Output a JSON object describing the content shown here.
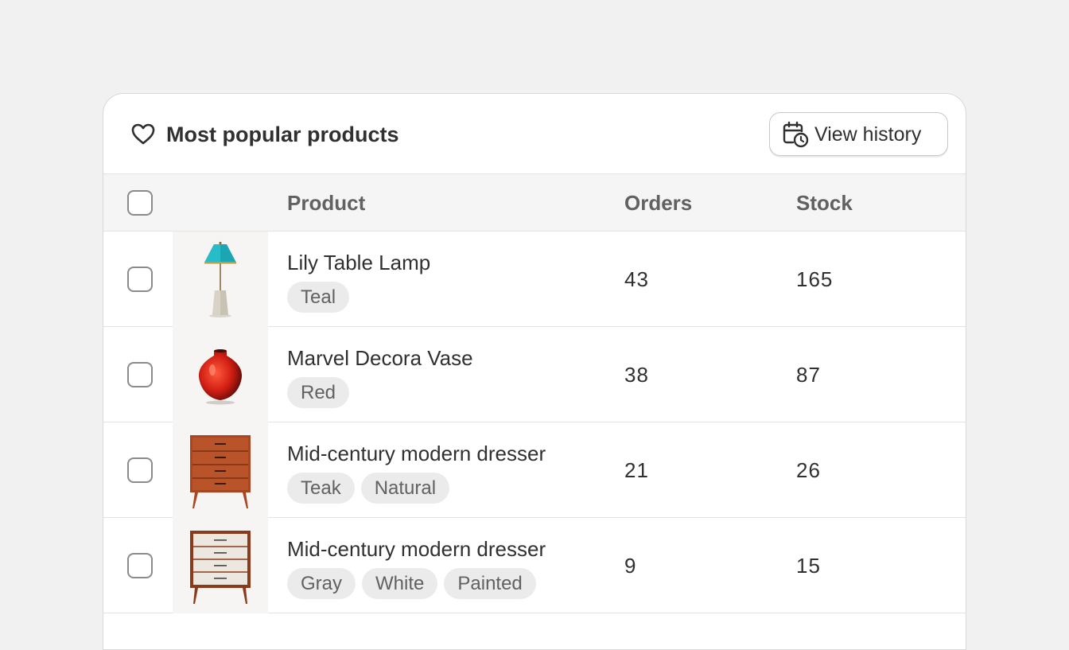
{
  "card": {
    "title": "Most popular products",
    "title_icon": "heart-icon",
    "history_button": {
      "label": "View history",
      "icon": "calendar-clock-icon"
    }
  },
  "table": {
    "columns": {
      "product": "Product",
      "orders": "Orders",
      "stock": "Stock"
    },
    "rows": [
      {
        "name": "Lily Table Lamp",
        "tags": [
          "Teal"
        ],
        "orders": "43",
        "stock": "165",
        "image": "table-lamp"
      },
      {
        "name": "Marvel Decora Vase",
        "tags": [
          "Red"
        ],
        "orders": "38",
        "stock": "87",
        "image": "vase"
      },
      {
        "name": "Mid-century modern dresser",
        "tags": [
          "Teak",
          "Natural"
        ],
        "orders": "21",
        "stock": "26",
        "image": "teak-dresser"
      },
      {
        "name": "Mid-century modern dresser",
        "tags": [
          "Gray",
          "White",
          "Painted"
        ],
        "orders": "9",
        "stock": "15",
        "image": "white-dresser"
      }
    ]
  },
  "colors": {
    "page_bg": "#f1f1f1",
    "card_bg": "#ffffff",
    "header_row_bg": "#f5f5f5",
    "tag_bg": "#ebebeb",
    "text": "#303030",
    "muted_text": "#616161"
  }
}
